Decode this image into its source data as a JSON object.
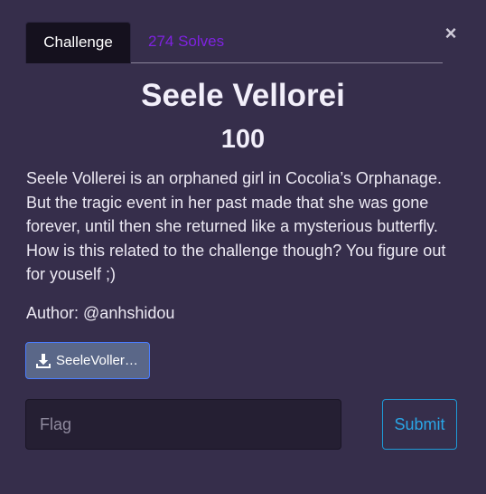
{
  "tabs": {
    "challenge_label": "Challenge",
    "solves_label": "274 Solves"
  },
  "close_label": "×",
  "challenge": {
    "name": "Seele Vellorei",
    "points": "100",
    "description_lines": [
      "Seele Vollerei is an orphaned girl in Cocolia’s Orphanage.",
      "But the tragic event in her past made that she was gone",
      "forever, until then she returned like a mysterious butterfly.",
      "How is this related to the challenge though? You figure out",
      "for youself ;)"
    ],
    "author": "Author: @anhshidou",
    "file_label": "SeeleVoller…",
    "file_icon": "download-icon"
  },
  "flag_form": {
    "placeholder": "Flag",
    "value": "",
    "submit_label": "Submit"
  },
  "colors": {
    "background": "#362e4b",
    "solves": "#7e22e0",
    "submit": "#2aa6e6",
    "file_button": "#5a6788"
  }
}
